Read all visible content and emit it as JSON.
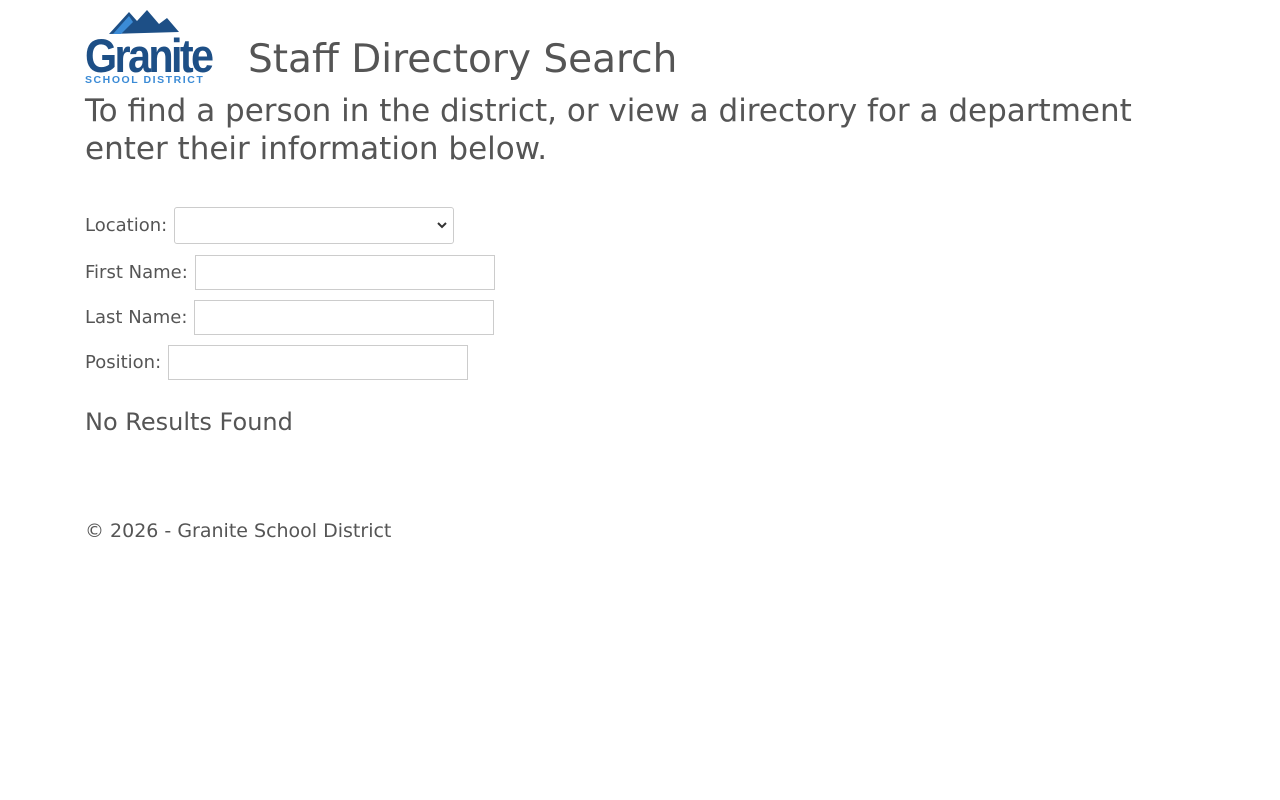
{
  "header": {
    "logo": {
      "wordmark": "Granite",
      "subtitle": "SCHOOL DISTRICT",
      "primary_color": "#1d4f86",
      "accent_color": "#3b8bd6"
    },
    "title": "Staff Directory Search"
  },
  "intro": "To find a person in the district, or view a directory for a department enter their information below.",
  "form": {
    "location": {
      "label": "Location:",
      "value": ""
    },
    "first_name": {
      "label": "First Name:",
      "value": "",
      "placeholder": ""
    },
    "last_name": {
      "label": "Last Name:",
      "value": "",
      "placeholder": ""
    },
    "position": {
      "label": "Position:",
      "value": "",
      "placeholder": ""
    }
  },
  "results": {
    "message": "No Results Found"
  },
  "footer": {
    "copyright": "© 2026 - Granite School District"
  },
  "colors": {
    "text": "#555555",
    "input_border": "#cccccc"
  }
}
